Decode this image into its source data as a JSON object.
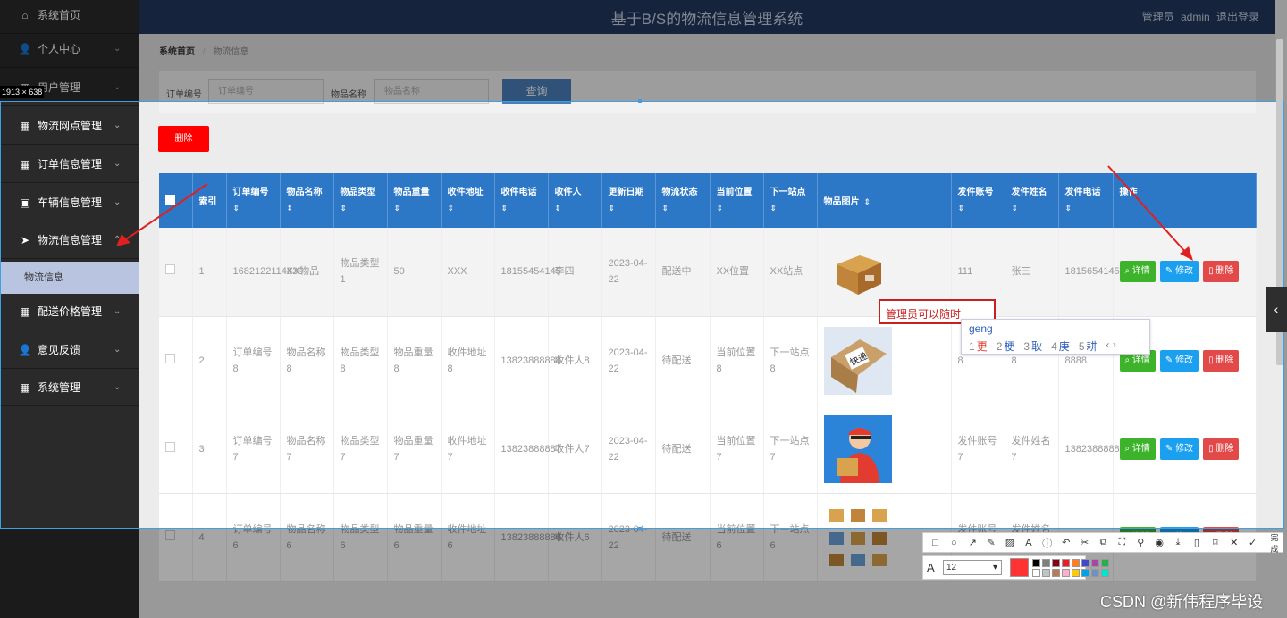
{
  "app": {
    "title": "基于B/S的物流信息管理系统",
    "user_text": "管理员 admin  退出登录"
  },
  "sidebar": {
    "items": [
      {
        "label": "系统首页",
        "icon": "home-icon",
        "glyph": "⌂",
        "chevron": ""
      },
      {
        "label": "个人中心",
        "icon": "user-icon",
        "glyph": "👤",
        "chevron": "⌄"
      },
      {
        "label": "用户管理",
        "icon": "grid-icon",
        "glyph": "▦",
        "chevron": "⌄"
      },
      {
        "label": "物流网点管理",
        "icon": "grid-icon",
        "glyph": "▦",
        "chevron": "⌄"
      },
      {
        "label": "订单信息管理",
        "icon": "grid-icon",
        "glyph": "▦",
        "chevron": "⌄"
      },
      {
        "label": "车辆信息管理",
        "icon": "briefcase-icon",
        "glyph": "▣",
        "chevron": "⌄"
      },
      {
        "label": "物流信息管理",
        "icon": "send-icon",
        "glyph": "➤",
        "chevron": "⌃"
      },
      {
        "label": "配送价格管理",
        "icon": "grid-icon",
        "glyph": "▦",
        "chevron": "⌄"
      },
      {
        "label": "意见反馈",
        "icon": "user-icon",
        "glyph": "👤",
        "chevron": "⌄"
      },
      {
        "label": "系统管理",
        "icon": "grid-icon",
        "glyph": "▦",
        "chevron": "⌄"
      }
    ],
    "sub_item": "物流信息"
  },
  "breadcrumb": {
    "home": "系统首页",
    "sep": "/",
    "current": "物流信息"
  },
  "search": {
    "order_label": "订单编号",
    "order_placeholder": "订单编号",
    "item_label": "物品名称",
    "item_placeholder": "物品名称",
    "query_button": "查询"
  },
  "delete_button": "删除",
  "screenshot_size_label": "1913 × 638",
  "table": {
    "headers": [
      "索引",
      "订单编号",
      "物品名称",
      "物品类型",
      "物品重量",
      "收件地址",
      "收件电话",
      "收件人",
      "更新日期",
      "物流状态",
      "当前位置",
      "下一站点",
      "物品图片",
      "发件账号",
      "发件姓名",
      "发件电话",
      "操作"
    ],
    "sort_icon": "⇕",
    "rows": [
      {
        "idx": "1",
        "order": "1682122114830",
        "name": "XX物品",
        "type": "物品类型1",
        "weight": "50",
        "addr": "XXX",
        "phone": "18155454145",
        "recv": "李四",
        "date": "2023-04-22",
        "status": "配送中",
        "pos": "XX位置",
        "next": "XX站点",
        "pic": "box",
        "acct": "111",
        "sname": "张三",
        "sphone": "18156541454"
      },
      {
        "idx": "2",
        "order": "订单编号8",
        "name": "物品名称8",
        "type": "物品类型8",
        "weight": "物品重量8",
        "addr": "收件地址8",
        "phone": "13823888888",
        "recv": "收件人8",
        "date": "2023-04-22",
        "status": "待配送",
        "pos": "当前位置8",
        "next": "下一站点8",
        "pic": "express",
        "acct": "8",
        "sname": "8",
        "sphone": "8888"
      },
      {
        "idx": "3",
        "order": "订单编号7",
        "name": "物品名称7",
        "type": "物品类型7",
        "weight": "物品重量7",
        "addr": "收件地址7",
        "phone": "13823888887",
        "recv": "收件人7",
        "date": "2023-04-22",
        "status": "待配送",
        "pos": "当前位置7",
        "next": "下一站点7",
        "pic": "courier",
        "acct": "发件账号7",
        "sname": "发件姓名7",
        "sphone": "13823888887"
      },
      {
        "idx": "4",
        "order": "订单编号6",
        "name": "物品名称6",
        "type": "物品类型6",
        "weight": "物品重量6",
        "addr": "收件地址6",
        "phone": "13823888886",
        "recv": "收件人6",
        "date": "2023-04-22",
        "status": "待配送",
        "pos": "当前位置6",
        "next": "下一站点6",
        "pic": "boxes",
        "acct": "发件账号6",
        "sname": "发件姓名6",
        "sphone": "13823888886"
      }
    ],
    "actions": {
      "detail": "详情",
      "edit": "修改",
      "delete": "删除"
    }
  },
  "annotation": {
    "note_text": "管理员可以随时",
    "ime_composition": "geng",
    "ime_candidates": [
      {
        "n": "1",
        "c": "更"
      },
      {
        "n": "2",
        "c": "梗"
      },
      {
        "n": "3",
        "c": "耿"
      },
      {
        "n": "4",
        "c": "庚"
      },
      {
        "n": "5",
        "c": "耕"
      }
    ],
    "ime_nav": "‹ ›"
  },
  "toolbar": {
    "tools": [
      "□",
      "○",
      "↗",
      "✎",
      "▨",
      "A",
      "ⓘ",
      "↶",
      "✂",
      "⧉",
      "⛶",
      "⚲",
      "◉",
      "⤓",
      "▯",
      "⌑",
      "✕",
      "✓"
    ],
    "done_label": "完成",
    "font_size": "12",
    "current_color": "#ff3333",
    "palette": [
      "#000000",
      "#7f7f7f",
      "#880015",
      "#ed1c24",
      "#ff7f27",
      "#3f48cc",
      "#a349a4",
      "#22b14c",
      "#ffffff",
      "#c3c3c3",
      "#b97a57",
      "#ffaec9",
      "#ffc90e",
      "#00a2e8",
      "#7092be",
      "#00e5d0"
    ]
  },
  "watermark": "CSDN @新伟程序毕设",
  "colors": {
    "accent": "#2c78c6",
    "sidebar": "#2a2a2a",
    "danger": "#ff0000"
  }
}
